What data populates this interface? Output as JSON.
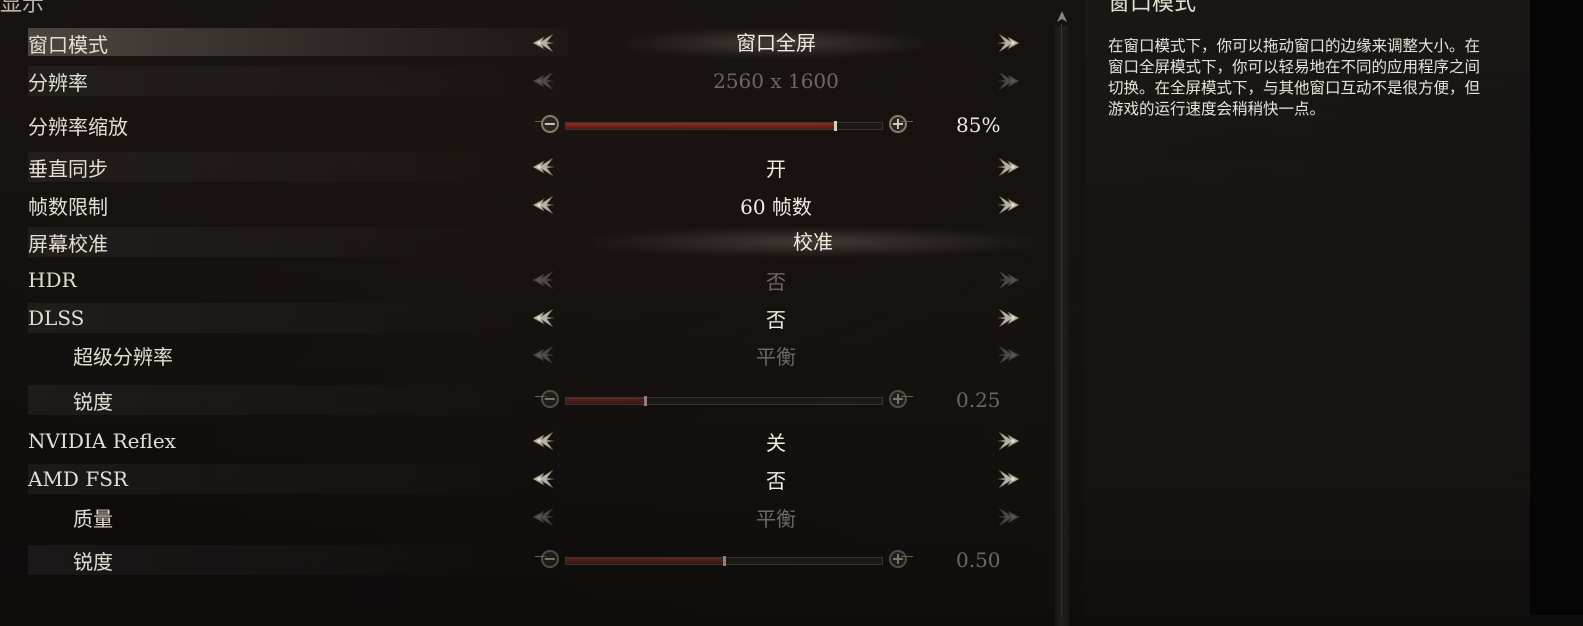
{
  "section": {
    "title": "显示"
  },
  "settings": [
    {
      "label": "窗口模式",
      "value": "窗口全屏"
    },
    {
      "label": "分辨率",
      "value": "2560 x 1600"
    },
    {
      "label": "分辨率缩放",
      "value": "85%",
      "slider_fraction": 0.85
    },
    {
      "label": "垂直同步",
      "value": "开"
    },
    {
      "label": "帧数限制",
      "value": "60 帧数"
    },
    {
      "label": "屏幕校准",
      "value": "校准"
    },
    {
      "label": "HDR",
      "value": "否"
    },
    {
      "label": "DLSS",
      "value": "否"
    },
    {
      "label": "超级分辨率",
      "value": "平衡"
    },
    {
      "label": "锐度",
      "value": "0.25",
      "slider_fraction": 0.25
    },
    {
      "label": "NVIDIA Reflex",
      "value": "关"
    },
    {
      "label": "AMD FSR",
      "value": "否"
    },
    {
      "label": "质量",
      "value": "平衡"
    },
    {
      "label": "锐度",
      "value": "0.50",
      "slider_fraction": 0.5
    }
  ],
  "description": {
    "title": "窗口模式",
    "text": "在窗口模式下，你可以拖动窗口的边缘来调整大小。在窗口全屏模式下，你可以轻易地在不同的应用程序之间切换。在全屏模式下，与其他窗口互动不是很方便，但游戏的运行速度会稍稍快一点。"
  },
  "icons": {
    "left_arrow": "ornate-left-arrow-icon",
    "right_arrow": "ornate-right-arrow-icon",
    "slider_minus": "minus-icon",
    "slider_plus": "plus-icon",
    "scroll_up": "scroll-up-icon"
  },
  "colors": {
    "background": "#0f0d0c",
    "slider_fill": "#8e2a22",
    "text": "#e8e2d9",
    "disabled_text": "#6e6862"
  }
}
